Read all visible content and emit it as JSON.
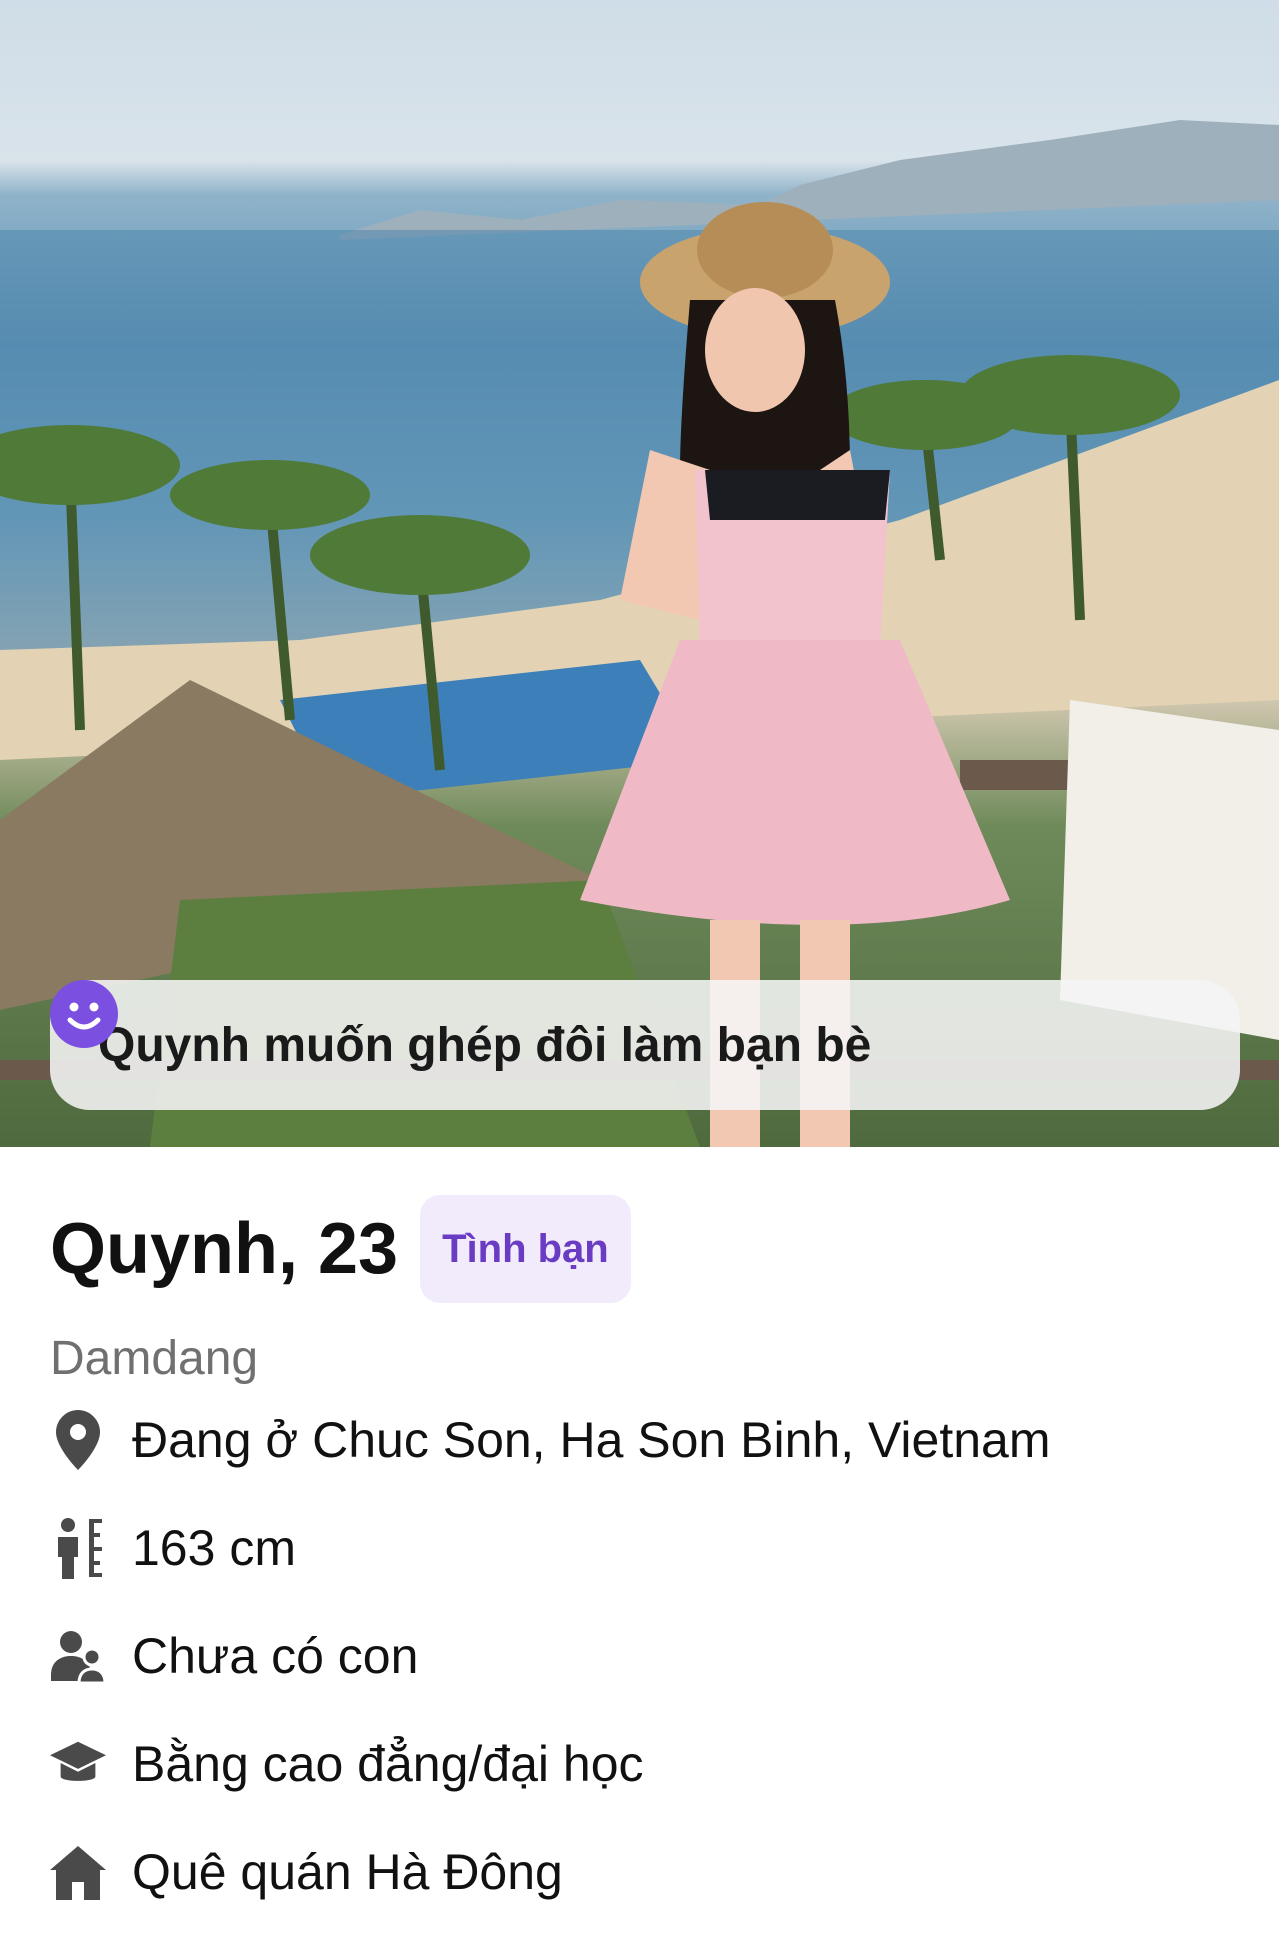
{
  "banner": {
    "text": "Quynh muốn ghép đôi làm bạn bè",
    "icon": "smiley-face-icon",
    "icon_color": "#7b4fe0"
  },
  "profile": {
    "name_age": "Quynh, 23",
    "tag": "Tình bạn",
    "subtitle": "Damdang"
  },
  "details": [
    {
      "icon": "location-pin-icon",
      "text": "Đang ở Chuc Son, Ha Son Binh, Vietnam"
    },
    {
      "icon": "height-icon",
      "text": "163 cm"
    },
    {
      "icon": "children-icon",
      "text": "Chưa có con"
    },
    {
      "icon": "graduation-cap-icon",
      "text": "Bằng cao đẳng/đại học"
    },
    {
      "icon": "home-icon",
      "text": "Quê quán Hà Đông"
    }
  ],
  "colors": {
    "accent": "#6a3bc3",
    "tag_bg": "#f1ebfb",
    "icon_gray": "#4a4a4a"
  }
}
